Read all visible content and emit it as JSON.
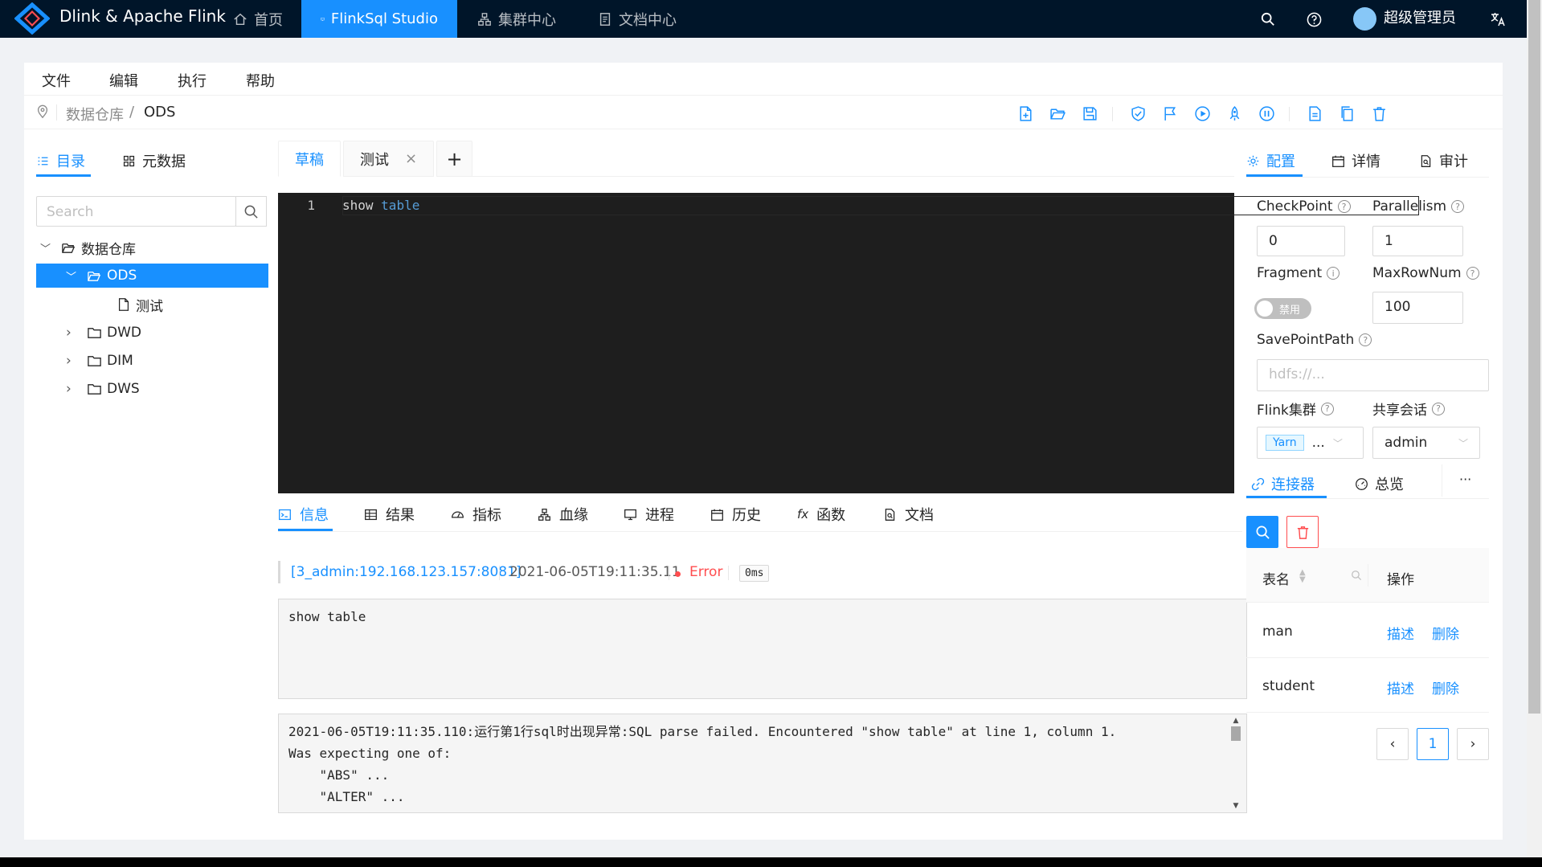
{
  "header": {
    "brand": "Dlink & Apache Flink",
    "nav": [
      {
        "label": "首页",
        "icon": "home-icon"
      },
      {
        "label": "FlinkSql Studio",
        "icon": "desktop-icon"
      },
      {
        "label": "集群中心",
        "icon": "cluster-icon"
      },
      {
        "label": "文档中心",
        "icon": "document-icon"
      }
    ],
    "user": "超级管理员"
  },
  "menu": [
    "文件",
    "编辑",
    "执行",
    "帮助"
  ],
  "breadcrumb": {
    "root": "数据仓库",
    "separator": "/",
    "current": "ODS"
  },
  "left": {
    "tabs": [
      "目录",
      "元数据"
    ],
    "search_placeholder": "Search",
    "tree": {
      "root": "数据仓库",
      "selected": "ODS",
      "child_file": "测试",
      "siblings": [
        "DWD",
        "DIM",
        "DWS"
      ]
    }
  },
  "editor": {
    "tabs": [
      "草稿",
      "测试"
    ],
    "add": "+",
    "close": "×",
    "line_number": "1",
    "code_kw": "show",
    "code_rest": "table"
  },
  "bottom_tabs": [
    "信息",
    "结果",
    "指标",
    "血缘",
    "进程",
    "历史",
    "函数",
    "文档"
  ],
  "result": {
    "session": "[3_admin:192.168.123.157:8081]",
    "time": "2021-06-05T19:11:35.11",
    "status": "Error",
    "duration": "0ms",
    "statement": "show table",
    "log": "2021-06-05T19:11:35.110:运行第1行sql时出现异常:SQL parse failed. Encountered \"show table\" at line 1, column 1.\nWas expecting one of:\n    \"ABS\" ...\n    \"ALTER\" ...\n    \"ARRAY\" ..."
  },
  "right": {
    "tabs": [
      "配置",
      "详情",
      "审计"
    ],
    "checkpoint_label": "CheckPoint",
    "checkpoint_value": "0",
    "parallelism_label": "Parallelism",
    "parallelism_value": "1",
    "fragment_label": "Fragment",
    "fragment_switch": "禁用",
    "maxrownum_label": "MaxRowNum",
    "maxrownum_value": "100",
    "savepoint_label": "SavePointPath",
    "savepoint_placeholder": "hdfs://...",
    "cluster_label": "Flink集群",
    "cluster_tag": "Yarn",
    "cluster_more": "...",
    "session_label": "共享会话",
    "session_value": "admin",
    "lower_tabs": [
      "连接器",
      "总览"
    ],
    "more": "···",
    "table": {
      "col_name": "表名",
      "col_ops": "操作",
      "rows": [
        {
          "name": "man",
          "describe": "描述",
          "delete": "删除"
        },
        {
          "name": "student",
          "describe": "描述",
          "delete": "删除"
        }
      ]
    },
    "page": "1"
  },
  "colors": {
    "primary": "#1890ff",
    "header": "#001529",
    "error": "#ff4d4f"
  }
}
